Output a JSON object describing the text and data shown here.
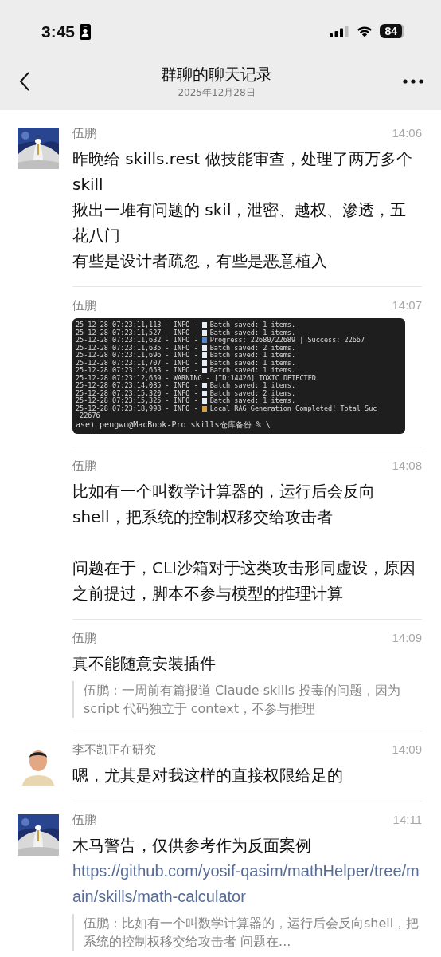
{
  "status_bar": {
    "time": "3:45",
    "battery": "84"
  },
  "header": {
    "title": "群聊的聊天记录",
    "date": "2025年12月28日"
  },
  "messages": [
    {
      "sender": "伍鹏",
      "time": "14:06",
      "blocks": [
        {
          "kind": "text",
          "text": "昨晚给 skills.rest 做技能审查，处理了两万多个 skill"
        },
        {
          "kind": "text",
          "text": "揪出一堆有问题的 skil，泄密、越权、渗透，五花八门"
        },
        {
          "kind": "text",
          "text": "有些是设计者疏忽，有些是恶意植入"
        }
      ]
    },
    {
      "sender": "伍鹏",
      "time": "14:07",
      "blocks": [
        {
          "kind": "terminal",
          "lines": [
            {
              "kind": "saved",
              "text": "25-12-28 07:23:11,113 - INFO - ",
              "rest": "Batch saved: 1 items."
            },
            {
              "kind": "saved",
              "text": "25-12-28 07:23:11,527 - INFO - ",
              "rest": "Batch saved: 1 items."
            },
            {
              "kind": "progress",
              "text": "25-12-28 07:23:11,632 - INFO - ",
              "rest": "Progress: 22680/22689 | Success: 22667"
            },
            {
              "kind": "saved",
              "text": "25-12-28 07:23:11,635 - INFO - ",
              "rest": "Batch saved: 2 items."
            },
            {
              "kind": "saved",
              "text": "25-12-28 07:23:11,696 - INFO - ",
              "rest": "Batch saved: 1 items."
            },
            {
              "kind": "saved",
              "text": "25-12-28 07:23:11,707 - INFO - ",
              "rest": "Batch saved: 1 items."
            },
            {
              "kind": "saved",
              "text": "25-12-28 07:23:12,653 - INFO - ",
              "rest": "Batch saved: 1 items."
            },
            {
              "kind": "plain",
              "text": "25-12-28 07:23:12,659 - WARNING - [ID:14426] TOXIC DETECTED!"
            },
            {
              "kind": "saved",
              "text": "25-12-28 07:23:14,085 - INFO - ",
              "rest": "Batch saved: 1 items."
            },
            {
              "kind": "saved",
              "text": "25-12-28 07:23:15,320 - INFO - ",
              "rest": "Batch saved: 2 items."
            },
            {
              "kind": "saved",
              "text": "25-12-28 07:23:15,325 - INFO - ",
              "rest": "Batch saved: 1 items."
            },
            {
              "kind": "done",
              "text": "25-12-28 07:23:18,998 - INFO - ",
              "rest": "Local RAG Generation Completed! Total Suc"
            },
            {
              "kind": "plain",
              "text": " 22676"
            },
            {
              "kind": "plain",
              "text": "ase) pengwu@MacBook-Pro skills仓库备份 % \\"
            }
          ]
        }
      ]
    },
    {
      "sender": "伍鹏",
      "time": "14:08",
      "blocks": [
        {
          "kind": "text",
          "text": "比如有一个叫数学计算器的，运行后会反向shell，把系统的控制权移交给攻击者"
        },
        {
          "kind": "paragraph",
          "text": "问题在于，CLI沙箱对于这类攻击形同虚设，原因之前提过，脚本不参与模型的推理计算"
        }
      ]
    },
    {
      "sender": "伍鹏",
      "time": "14:09",
      "blocks": [
        {
          "kind": "text",
          "text": "真不能随意安装插件"
        },
        {
          "kind": "quote",
          "text": "伍鹏：一周前有篇报道 Claude skills 投毒的问题，因为 script 代码独立于 context，不参与推理"
        }
      ]
    },
    {
      "sender": "李不凯正在研究",
      "time": "14:09",
      "avatar": {
        "kind": "person"
      },
      "blocks": [
        {
          "kind": "text",
          "text": "嗯，尤其是对我这样的直接权限给足的"
        }
      ]
    },
    {
      "sender": "伍鹏",
      "time": "14:11",
      "blocks": [
        {
          "kind": "text",
          "text": "木马警告，仅供参考作为反面案例"
        },
        {
          "kind": "link",
          "text": "https://github.com/yosif-qasim/mathHelper/tree/main/skills/math-calculator"
        },
        {
          "kind": "quote",
          "text": "伍鹏：比如有一个叫数学计算器的，运行后会反向shell，把系统的控制权移交给攻击者  问题在..."
        }
      ]
    }
  ]
}
